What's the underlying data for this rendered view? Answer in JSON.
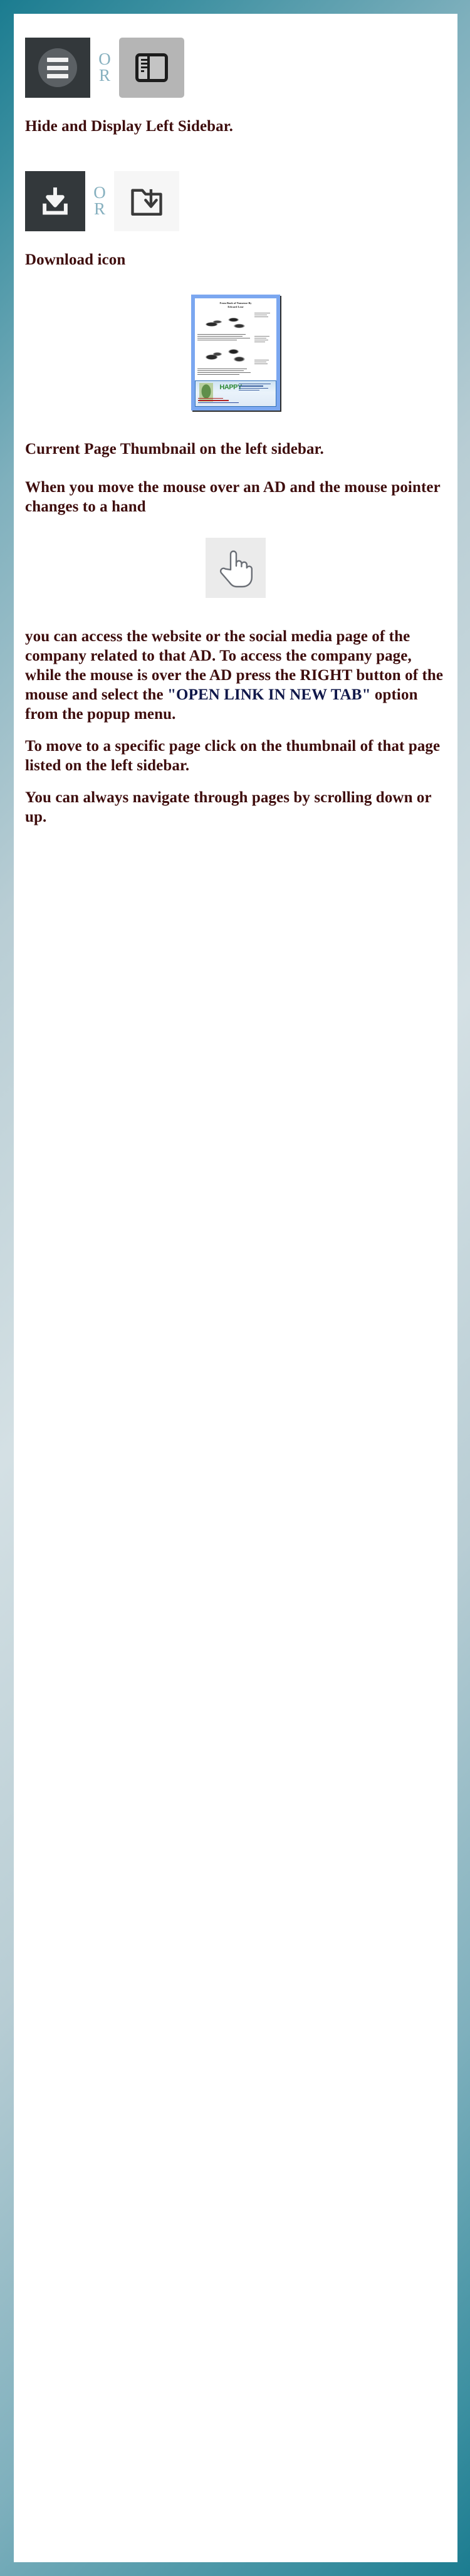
{
  "frame": {
    "border_color": "#1b7c90",
    "background": "#ffffff"
  },
  "colors": {
    "heading_text": "#3e0d0d",
    "body_text": "#3e0d0d",
    "or_text": "#86b0bf",
    "highlight_text": "#10184a",
    "dark_tile": "#33383b",
    "grey_tile": "#b5b5b5",
    "light_tile": "#f6f6f6",
    "hand_tile": "#ebebeb",
    "thumb_frame": "#7ba7f0"
  },
  "sections": {
    "sidebar_toggle": {
      "or_label_line1": "O",
      "or_label_line2": "R",
      "caption": "Hide and Display Left Sidebar.",
      "left_icon_name": "hamburger-menu-icon",
      "right_icon_name": "toggle-sidebar-icon"
    },
    "download": {
      "or_label_line1": "O",
      "or_label_line2": "R",
      "caption": "Download icon",
      "left_icon_name": "download-arrow-icon",
      "right_icon_name": "folder-download-icon"
    },
    "thumbnail": {
      "page_title_line1": "From Book of Nonsense By",
      "page_title_line2": "Edward Lear",
      "ad_text": "HAPPY",
      "caption": "Current Page Thumbnail on the left sidebar."
    },
    "hand_cursor": {
      "intro": "When you move the mouse over an AD and the mouse pointer changes to a hand",
      "icon_name": "hand-pointer-cursor-icon"
    },
    "access_paragraph": {
      "part1": " you can access the website or the social media page of  the company related to that AD.  To access the company page, while the mouse is over the AD press the RIGHT button of  the mouse and select the ",
      "highlight": "\"OPEN LINK IN NEW TAB\"",
      "part2": " option from the popup menu."
    },
    "specific_page_paragraph": {
      "text": "To move to a specific page click on the thumbnail of  that page listed on the left sidebar."
    },
    "navigate_paragraph": {
      "text": "You can always navigate through pages by scrolling down or up."
    }
  }
}
